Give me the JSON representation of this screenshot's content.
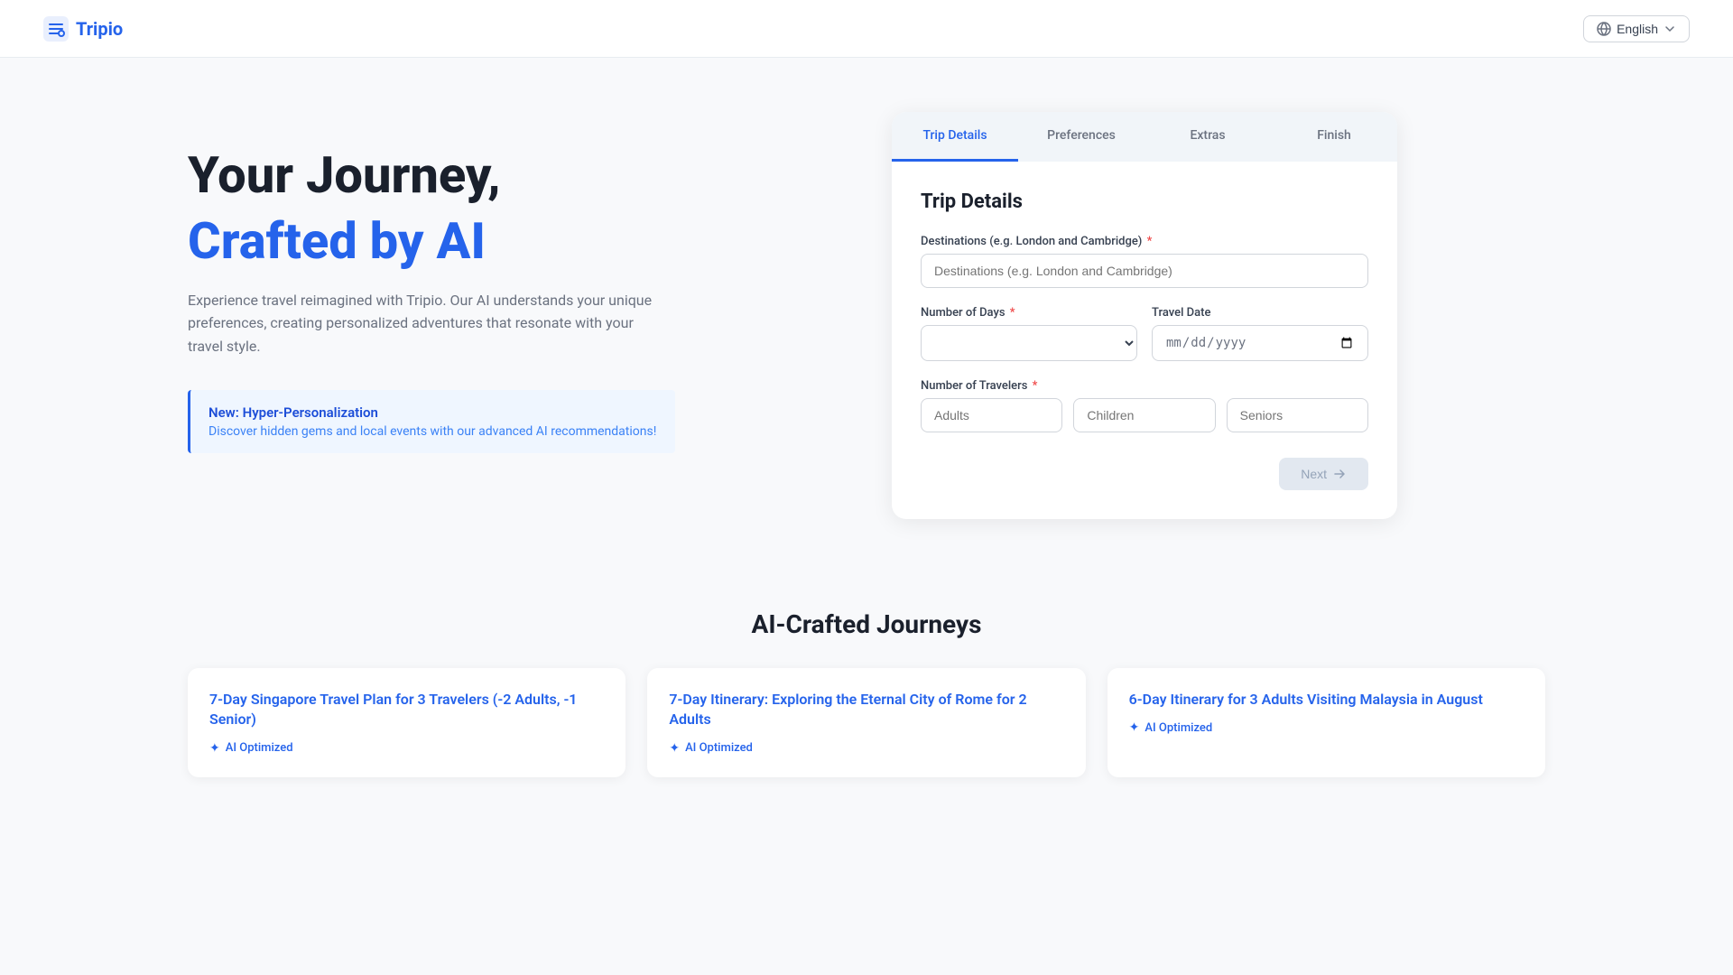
{
  "header": {
    "logo_text": "Tripio",
    "lang_label": "English"
  },
  "hero": {
    "title_line1": "Your Journey,",
    "title_line2": "Crafted by AI",
    "subtitle": "Experience travel reimagined with Tripio. Our AI understands your unique preferences, creating personalized adventures that resonate with your travel style.",
    "highlight_title": "New: Hyper-Personalization",
    "highlight_desc": "Discover hidden gems and local events with our advanced AI recommendations!"
  },
  "trip_form": {
    "title": "Trip Details",
    "tabs": [
      {
        "label": "Trip Details",
        "active": true
      },
      {
        "label": "Preferences",
        "active": false
      },
      {
        "label": "Extras",
        "active": false
      },
      {
        "label": "Finish",
        "active": false
      }
    ],
    "fields": {
      "destinations_label": "Destinations (e.g. London and Cambridge)",
      "destinations_placeholder": "Destinations (e.g. London and Cambridge)",
      "days_label": "Number of Days",
      "travel_date_label": "Travel Date",
      "travel_date_placeholder": "mm/dd/yyyy",
      "travelers_label": "Number of Travelers",
      "adults_placeholder": "Adults",
      "children_placeholder": "Children",
      "seniors_placeholder": "Seniors"
    },
    "next_button": "Next"
  },
  "journeys_section": {
    "title": "AI-Crafted Journeys",
    "cards": [
      {
        "title": "7-Day Singapore Travel Plan for 3 Travelers (-2 Adults, -1 Senior)",
        "badge": "AI Optimized"
      },
      {
        "title": "7-Day Itinerary: Exploring the Eternal City of Rome for 2 Adults",
        "badge": "AI Optimized"
      },
      {
        "title": "6-Day Itinerary for 3 Adults Visiting Malaysia in August",
        "badge": "AI Optimized"
      }
    ]
  },
  "colors": {
    "primary": "#2563eb",
    "text_dark": "#1a202c",
    "text_muted": "#6b7280",
    "border": "#d1d5db",
    "bg_light": "#f8f9fb"
  }
}
